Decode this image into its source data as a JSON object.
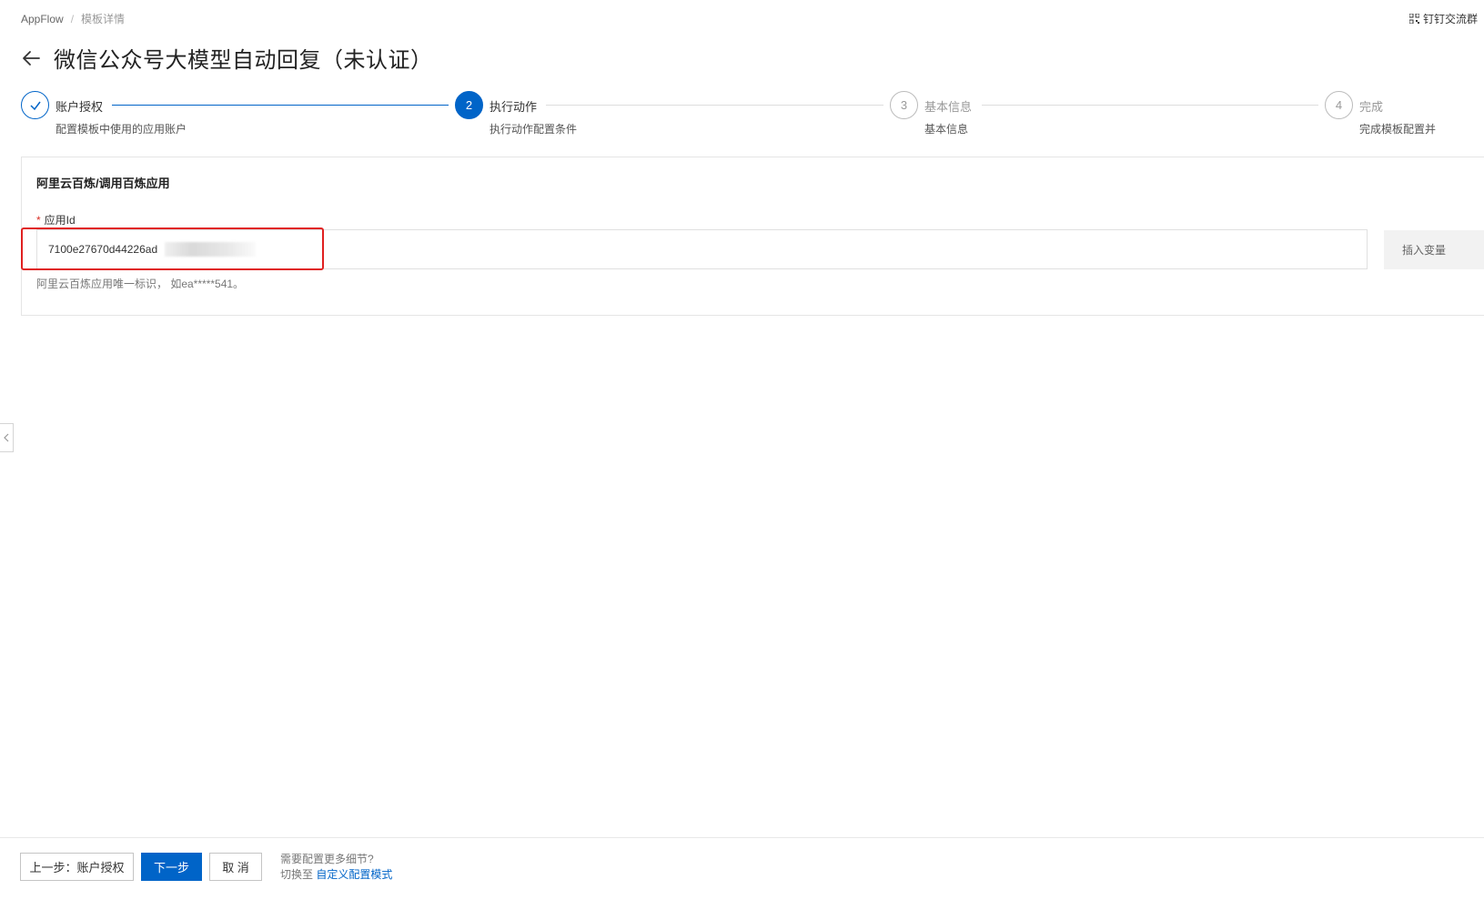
{
  "breadcrumb": {
    "root": "AppFlow",
    "separator": "/",
    "current": "模板详情"
  },
  "header": {
    "title": "微信公众号大模型自动回复（未认证）",
    "dingtalk_label": "钉钉交流群"
  },
  "steps": [
    {
      "number": "1",
      "title": "账户授权",
      "desc": "配置模板中使用的应用账户",
      "status": "done"
    },
    {
      "number": "2",
      "title": "执行动作",
      "desc": "执行动作配置条件",
      "status": "active"
    },
    {
      "number": "3",
      "title": "基本信息",
      "desc": "基本信息",
      "status": "todo"
    },
    {
      "number": "4",
      "title": "完成",
      "desc": "完成模板配置并",
      "status": "todo"
    }
  ],
  "card": {
    "title": "阿里云百炼/调用百炼应用",
    "field": {
      "required_mark": "*",
      "label": "应用Id",
      "value": "7100e27670d44226ad",
      "help": "阿里云百炼应用唯一标识， 如ea*****541。",
      "insert_label": "插入变量"
    }
  },
  "footer": {
    "prev_label": "上一步：账户授权",
    "next_label": "下一步",
    "cancel_label": "取 消",
    "hint_line1": "需要配置更多细节?",
    "hint_prefix": "切换至",
    "hint_link": "自定义配置模式"
  },
  "colors": {
    "primary": "#0064c8",
    "highlight": "#e02020",
    "required": "#d93026"
  }
}
